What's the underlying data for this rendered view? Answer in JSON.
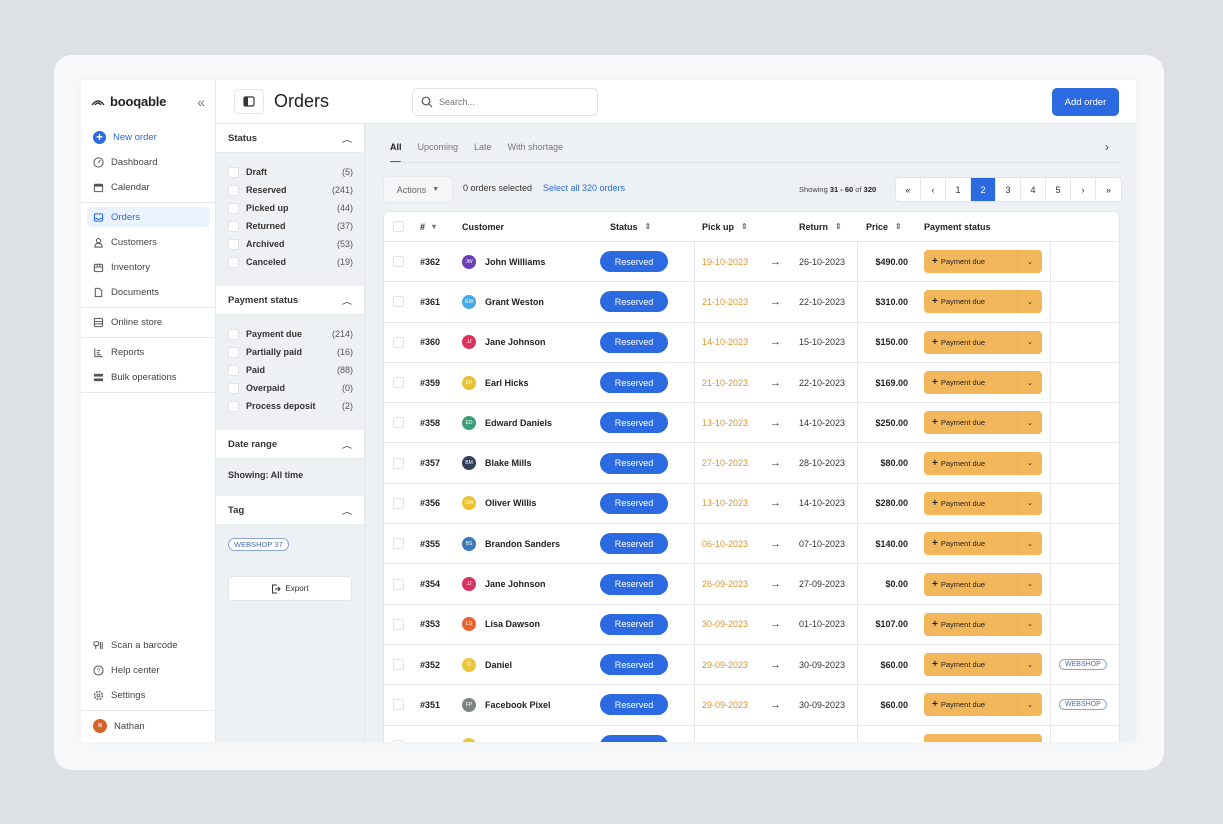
{
  "brand": {
    "name": "booqable"
  },
  "sidebar": {
    "new_order": "New order",
    "items": [
      {
        "label": "Dashboard",
        "icon": "dashboard-icon"
      },
      {
        "label": "Calendar",
        "icon": "calendar-icon"
      },
      {
        "label": "Orders",
        "icon": "inbox-icon",
        "active": true
      },
      {
        "label": "Customers",
        "icon": "user-icon"
      },
      {
        "label": "Inventory",
        "icon": "box-icon"
      },
      {
        "label": "Documents",
        "icon": "document-icon"
      },
      {
        "label": "Online store",
        "icon": "store-icon"
      },
      {
        "label": "Reports",
        "icon": "reports-icon"
      },
      {
        "label": "Bulk operations",
        "icon": "bulk-icon"
      }
    ],
    "bottom": [
      {
        "label": "Scan a barcode",
        "icon": "barcode-icon"
      },
      {
        "label": "Help center",
        "icon": "help-icon"
      },
      {
        "label": "Settings",
        "icon": "gear-icon"
      }
    ],
    "user": {
      "name": "Nathan",
      "initials": "N",
      "color": "#d4632c"
    }
  },
  "header": {
    "title": "Orders",
    "search_placeholder": "Search...",
    "add_order": "Add order"
  },
  "filters": {
    "status": {
      "title": "Status",
      "items": [
        {
          "label": "Draft",
          "count": "(5)"
        },
        {
          "label": "Reserved",
          "count": "(241)"
        },
        {
          "label": "Picked up",
          "count": "(44)"
        },
        {
          "label": "Returned",
          "count": "(37)"
        },
        {
          "label": "Archived",
          "count": "(53)"
        },
        {
          "label": "Canceled",
          "count": "(19)"
        }
      ]
    },
    "payment": {
      "title": "Payment status",
      "items": [
        {
          "label": "Payment due",
          "count": "(214)"
        },
        {
          "label": "Partially paid",
          "count": "(16)"
        },
        {
          "label": "Paid",
          "count": "(88)"
        },
        {
          "label": "Overpaid",
          "count": "(0)"
        },
        {
          "label": "Process deposit",
          "count": "(2)"
        }
      ]
    },
    "date": {
      "title": "Date range",
      "showing": "Showing: All time"
    },
    "tag": {
      "title": "Tag",
      "pill": "WEBSHOP  37"
    },
    "export": "Export"
  },
  "main": {
    "tabs": [
      "All",
      "Upcoming",
      "Late",
      "With shortage"
    ],
    "active_tab": "All",
    "actions": "Actions",
    "selected": "0 orders selected",
    "select_all": "Select all 320 orders",
    "showing": {
      "prefix": "Showing ",
      "range": "31 - 60",
      "of": " of ",
      "total": "320"
    },
    "pagination": {
      "pages": [
        "1",
        "2",
        "3",
        "4",
        "5"
      ],
      "current": "2",
      "first": "«",
      "prev": "‹",
      "next": "›",
      "last": "»"
    }
  },
  "table": {
    "columns": {
      "number": "#",
      "customer": "Customer",
      "status": "Status",
      "pickup": "Pick up",
      "return": "Return",
      "price": "Price",
      "payment": "Payment status"
    },
    "payment_label": "Payment due",
    "rows": [
      {
        "id": "#362",
        "initials": "JW",
        "color": "#6a3fb5",
        "customer": "John Williams",
        "status": "Reserved",
        "pickup": "19-10-2023",
        "return": "26-10-2023",
        "price": "$490.00",
        "tag": ""
      },
      {
        "id": "#361",
        "initials": "GW",
        "color": "#4aa8e8",
        "customer": "Grant Weston",
        "status": "Reserved",
        "pickup": "21-10-2023",
        "return": "22-10-2023",
        "price": "$310.00",
        "tag": ""
      },
      {
        "id": "#360",
        "initials": "JJ",
        "color": "#d6335f",
        "customer": "Jane Johnson",
        "status": "Reserved",
        "pickup": "14-10-2023",
        "return": "15-10-2023",
        "price": "$150.00",
        "tag": ""
      },
      {
        "id": "#359",
        "initials": "EH",
        "color": "#e6c136",
        "customer": "Earl Hicks",
        "status": "Reserved",
        "pickup": "21-10-2023",
        "return": "22-10-2023",
        "price": "$169.00",
        "tag": ""
      },
      {
        "id": "#358",
        "initials": "ED",
        "color": "#3e9e7a",
        "customer": "Edward Daniels",
        "status": "Reserved",
        "pickup": "13-10-2023",
        "return": "14-10-2023",
        "price": "$250.00",
        "tag": ""
      },
      {
        "id": "#357",
        "initials": "BM",
        "color": "#34405a",
        "customer": "Blake Mills",
        "status": "Reserved",
        "pickup": "27-10-2023",
        "return": "28-10-2023",
        "price": "$80.00",
        "tag": ""
      },
      {
        "id": "#356",
        "initials": "OW",
        "color": "#efc131",
        "customer": "Oliver Willis",
        "status": "Reserved",
        "pickup": "13-10-2023",
        "return": "14-10-2023",
        "price": "$280.00",
        "tag": ""
      },
      {
        "id": "#355",
        "initials": "BS",
        "color": "#3f78b7",
        "customer": "Brandon Sanders",
        "status": "Reserved",
        "pickup": "06-10-2023",
        "return": "07-10-2023",
        "price": "$140.00",
        "tag": ""
      },
      {
        "id": "#354",
        "initials": "JJ",
        "color": "#d6335f",
        "customer": "Jane Johnson",
        "status": "Reserved",
        "pickup": "26-09-2023",
        "return": "27-09-2023",
        "price": "$0.00",
        "tag": ""
      },
      {
        "id": "#353",
        "initials": "LD",
        "color": "#e8642e",
        "customer": "Lisa Dawson",
        "status": "Reserved",
        "pickup": "30-09-2023",
        "return": "01-10-2023",
        "price": "$107.00",
        "tag": ""
      },
      {
        "id": "#352",
        "initials": "D",
        "color": "#ecc63f",
        "customer": "Daniel",
        "status": "Reserved",
        "pickup": "29-09-2023",
        "return": "30-09-2023",
        "price": "$60.00",
        "tag": "WEBSHOP"
      },
      {
        "id": "#351",
        "initials": "FP",
        "color": "#7d8584",
        "customer": "Facebook Pixel",
        "status": "Reserved",
        "pickup": "29-09-2023",
        "return": "30-09-2023",
        "price": "$60.00",
        "tag": "WEBSHOP"
      },
      {
        "id": "",
        "initials": "",
        "color": "#ecc63f",
        "customer": "",
        "status": "",
        "pickup": "",
        "return": "",
        "price": "",
        "tag": ""
      }
    ]
  },
  "colors": {
    "accent": "#2b6ae0",
    "payment_due": "#f2b75b",
    "pickup_text": "#d9952f"
  }
}
